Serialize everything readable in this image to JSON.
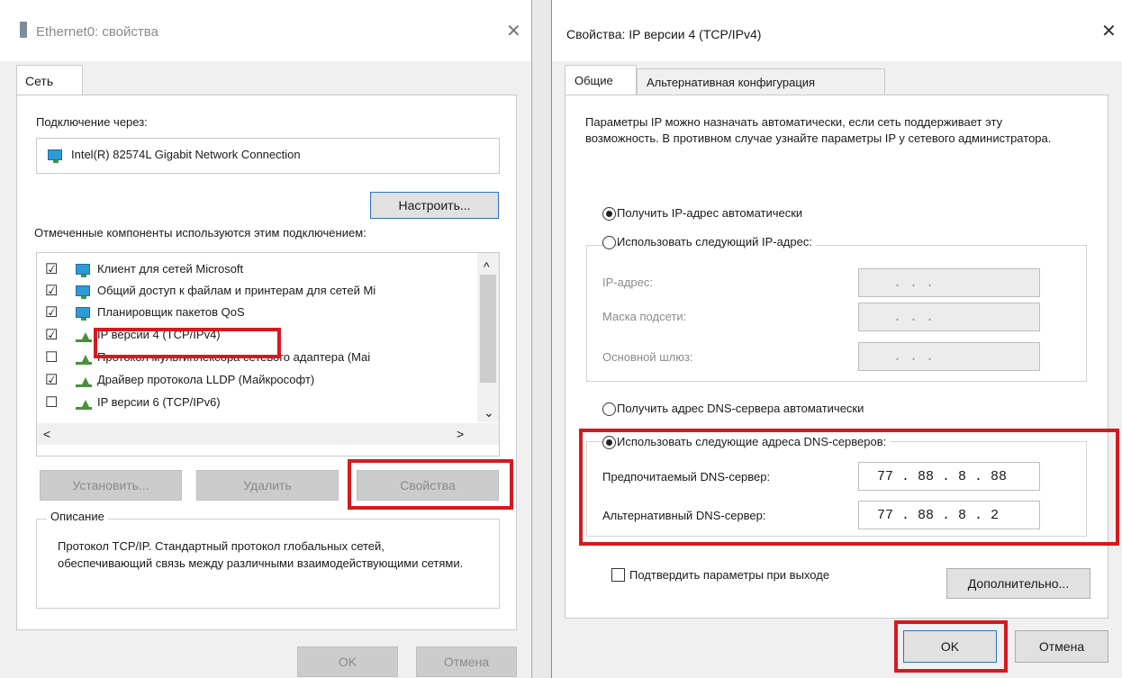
{
  "left_dialog": {
    "title": "Ethernet0: свойства",
    "close_glyph": "✕",
    "tab": "Сеть",
    "connect_label": "Подключение через:",
    "adapter": "Intel(R) 82574L Gigabit Network Connection",
    "configure_button": "Настроить...",
    "components_label": "Отмеченные компоненты используются этим подключением:",
    "components": [
      {
        "label": "Клиент для сетей Microsoft",
        "checked": "☑"
      },
      {
        "label": "Общий доступ к файлам и принтерам для сетей Mi",
        "checked": "☑"
      },
      {
        "label": "Планировщик пакетов QoS",
        "checked": "☑"
      },
      {
        "label": "IP версии 4 (TCP/IPv4)",
        "checked": "☑"
      },
      {
        "label": "Протокол мультиплексора сетевого адаптера (Mai",
        "checked": "☐"
      },
      {
        "label": "Драйвер протокола LLDP (Майкрософт)",
        "checked": "☑"
      },
      {
        "label": "IP версии 6 (TCP/IPv6)",
        "checked": "☐"
      }
    ],
    "scroll_up": "^",
    "scroll_down": "⌄",
    "scroll_left": "<",
    "scroll_right": ">",
    "install_button": "Установить...",
    "uninstall_button": "Удалить",
    "properties_button": "Свойства",
    "description_label": "Описание",
    "description_text": "Протокол TCP/IP. Стандартный протокол глобальных сетей, обеспечивающий связь между различными взаимодействующими сетями.",
    "ok_button": "OK",
    "cancel_button": "Отмена"
  },
  "right_dialog": {
    "title": "Свойства: IP версии 4 (TCP/IPv4)",
    "close_glyph": "✕",
    "tab_general": "Общие",
    "tab_alt": "Альтернативная конфигурация",
    "intro_text": "Параметры IP можно назначать автоматически, если сеть поддерживает эту возможность. В противном случае узнайте параметры IP у сетевого администратора.",
    "radio_auto_ip": "Получить IP-адрес автоматически",
    "radio_manual_ip": "Использовать следующий IP-адрес:",
    "ip_label": "IP-адрес:",
    "mask_label": "Маска подсети:",
    "gateway_label": "Основной шлюз:",
    "empty_ip": " .   .   . ",
    "radio_auto_dns": "Получить адрес DNS-сервера автоматически",
    "radio_manual_dns": "Использовать следующие адреса DNS-серверов:",
    "preferred_dns_label": "Предпочитаемый DNS-сервер:",
    "preferred_dns_value": "77 . 88 . 8 . 88",
    "alternate_dns_label": "Альтернативный DNS-сервер:",
    "alternate_dns_value": "77 . 88 . 8 . 2",
    "validate_label": "Подтвердить параметры при выходе",
    "advanced_button": "Дополнительно...",
    "ok_button": "OK",
    "cancel_button": "Отмена"
  },
  "colors": {
    "highlight": "#d7191f",
    "window_bg": "#f0f0f0",
    "focus_border": "#2d70c8"
  }
}
